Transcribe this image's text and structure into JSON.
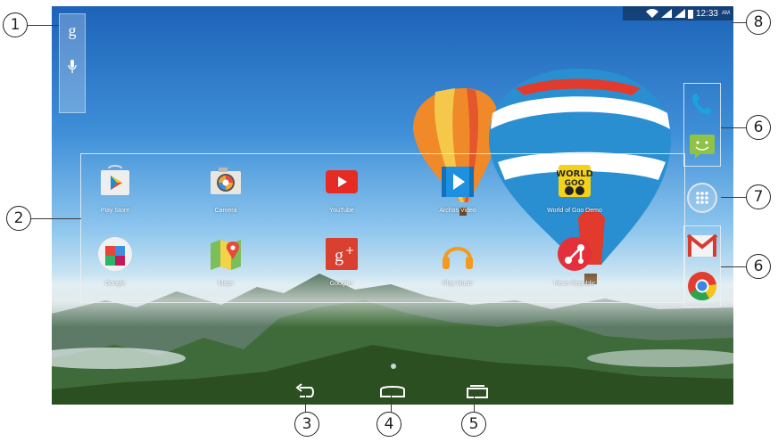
{
  "status_bar": {
    "time": "12:33",
    "ampm": "AM",
    "icons": [
      "wifi-icon",
      "signal-icon",
      "signal-icon",
      "battery-icon"
    ]
  },
  "google_search": {
    "logo": "g",
    "icons": [
      "google-search-icon",
      "microphone-icon"
    ]
  },
  "apps": [
    {
      "label": "Play Store",
      "icon": "play-store-icon"
    },
    {
      "label": "Camera",
      "icon": "camera-icon"
    },
    {
      "label": "YouTube",
      "icon": "youtube-icon"
    },
    {
      "label": "Archos Video",
      "icon": "archos-video-icon"
    },
    {
      "label": "World of Goo Demo",
      "icon": "world-of-goo-icon"
    },
    {
      "label": "Google",
      "icon": "google-folder-icon"
    },
    {
      "label": "Maps",
      "icon": "maps-icon"
    },
    {
      "label": "Google+",
      "icon": "google-plus-icon"
    },
    {
      "label": "Play Music",
      "icon": "play-music-icon"
    },
    {
      "label": "News Republic",
      "icon": "news-republic-icon"
    }
  ],
  "dock_icons": [
    "phone-icon",
    "messaging-icon",
    "all-apps-icon",
    "gmail-icon",
    "chrome-icon"
  ],
  "nav_buttons": [
    "back-icon",
    "home-icon",
    "recent-apps-icon"
  ],
  "callouts": [
    "1",
    "2",
    "3",
    "4",
    "5",
    "6",
    "7",
    "6",
    "8"
  ]
}
